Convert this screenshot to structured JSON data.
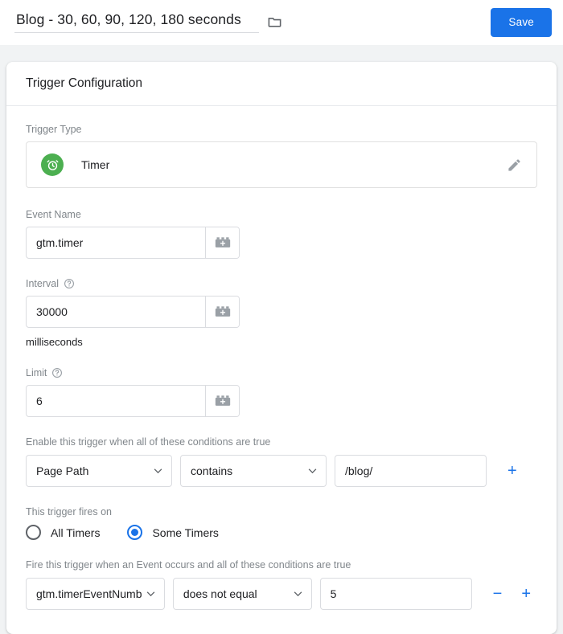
{
  "header": {
    "trigger_name": "Blog - 30, 60, 90, 120, 180 seconds",
    "folder_icon": "folder-icon",
    "save_label": "Save"
  },
  "card": {
    "section_title": "Trigger Configuration",
    "trigger_type": {
      "label": "Trigger Type",
      "icon": "timer-alarm-clock-icon",
      "name": "Timer",
      "edit_icon": "pencil-edit-icon"
    },
    "event_name": {
      "label": "Event Name",
      "value": "gtm.timer",
      "placeholder": "",
      "picker_icon": "variable-picker-brick-icon"
    },
    "interval": {
      "label": "Interval",
      "help_icon": "help-question-icon",
      "value": "30000",
      "placeholder": "",
      "picker_icon": "variable-picker-brick-icon",
      "units_hint": "milliseconds"
    },
    "limit": {
      "label": "Limit",
      "help_icon": "help-question-icon",
      "value": "6",
      "placeholder": "",
      "picker_icon": "variable-picker-brick-icon"
    },
    "enable_conditions": {
      "label": "Enable this trigger when all of these conditions are true",
      "variable": "Page Path",
      "operator": "contains",
      "value": "/blog/",
      "placeholder": "",
      "add_label": "+",
      "caret_icon": "chevron-down-icon"
    },
    "fires_on": {
      "label": "This trigger fires on",
      "options": [
        {
          "label": "All Timers",
          "selected": false
        },
        {
          "label": "Some Timers",
          "selected": true
        }
      ]
    },
    "fire_conditions": {
      "label": "Fire this trigger when an Event occurs and all of these conditions are true",
      "variable": "gtm.timerEventNumb",
      "operator": "does not equal",
      "value": "5",
      "placeholder": "",
      "remove_label": "−",
      "add_label": "+",
      "caret_icon": "chevron-down-icon"
    }
  },
  "colors": {
    "accent_blue": "#1a73e8",
    "timer_green": "#4caf50",
    "page_background": "#f1f3f4",
    "border": "#dadce0"
  }
}
